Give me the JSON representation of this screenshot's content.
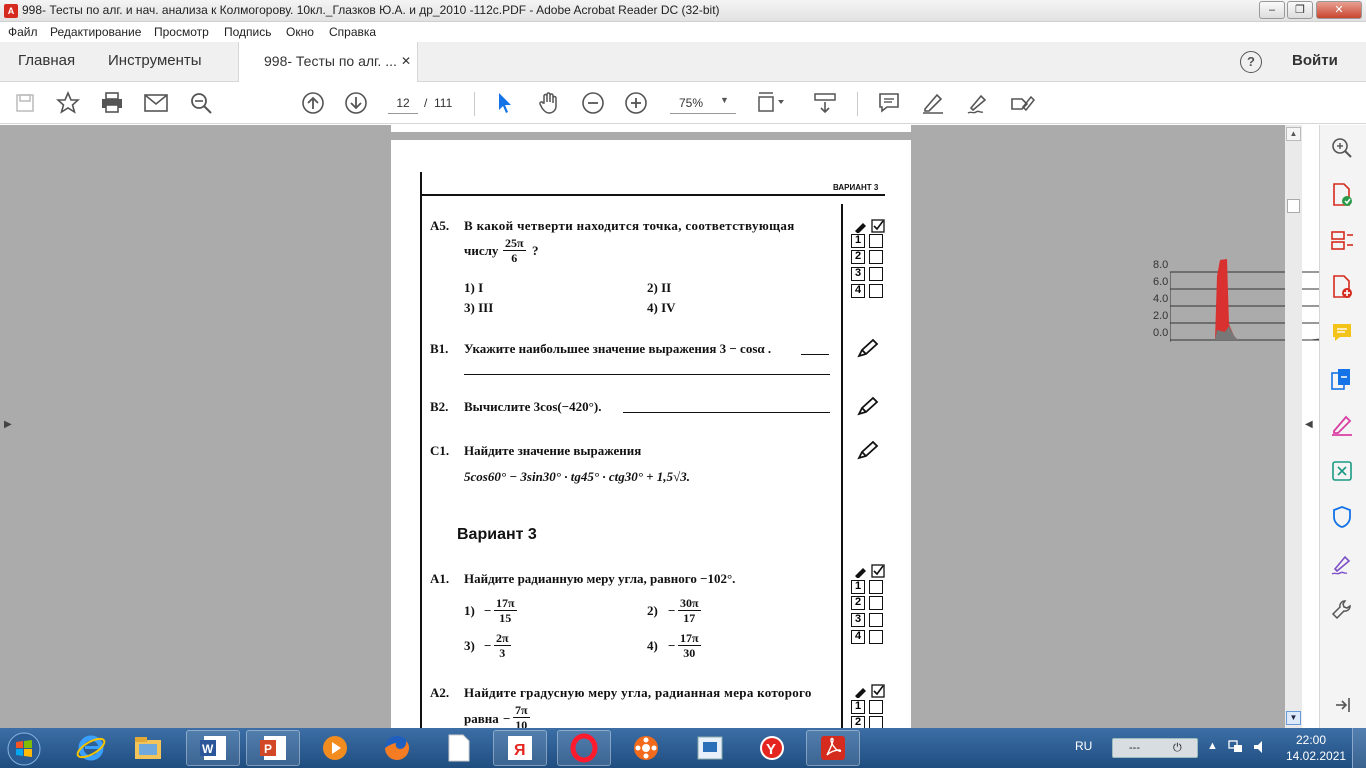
{
  "window": {
    "title": "998- Тесты по алг. и нач. анализа к Колмогорову. 10кл._Глазков Ю.А. и др_2010 -112с.PDF - Adobe Acrobat Reader DC (32-bit)",
    "app_icon": "acrobat-icon",
    "minimize": "–",
    "restore": "❐",
    "close": "✕"
  },
  "menu": [
    "Файл",
    "Редактирование",
    "Просмотр",
    "Подпись",
    "Окно",
    "Справка"
  ],
  "tabs": {
    "home": "Главная",
    "tools": "Инструменты",
    "document": "998- Тесты по алг. ...",
    "close": "✕",
    "help": "?",
    "signin": "Войти"
  },
  "toolbar": {
    "page_current": "12",
    "page_separator": "/",
    "page_total": "111",
    "zoom": "75%"
  },
  "overlay_chart": {
    "ticks": [
      "8.0",
      "6.0",
      "4.0",
      "2.0",
      "0.0"
    ]
  },
  "page": {
    "header": "ВАРИАНТ 3",
    "a5": {
      "num": "А5.",
      "text1": "В какой четверти находится точка, соответствующая",
      "text2": "числу",
      "frac_num": "25π",
      "frac_den": "6",
      "qmark": "?",
      "opt1": "1)  I",
      "opt2": "2)  II",
      "opt3": "3)  III",
      "opt4": "4)  IV"
    },
    "b1": {
      "num": "B1.",
      "text": "Укажите наибольшее значение выражения  3 − cosα ."
    },
    "b2": {
      "num": "B2.",
      "text": "Вычислите 3cos(−420°)."
    },
    "c1": {
      "num": "С1.",
      "text": "Найдите значение выражения",
      "expr": "5cos60° − 3sin30° · tg45° · ctg30° + 1,5√3."
    },
    "variant_title": "Вариант 3",
    "a1": {
      "num": "А1.",
      "text": "Найдите радианную меру угла, равного −102°.",
      "o1_label": "1)",
      "o1_num": "17π",
      "o1_den": "15",
      "o2_label": "2)",
      "o2_num": "30π",
      "o2_den": "17",
      "o3_label": "3)",
      "o3_num": "2π",
      "o3_den": "3",
      "o4_label": "4)",
      "o4_num": "17π",
      "o4_den": "30",
      "minus": "−"
    },
    "a2": {
      "num": "А2.",
      "text1": "Найдите градусную меру угла, радианная мера которого",
      "text2": "равна",
      "frac_num": "7π",
      "frac_den": "10"
    },
    "answer_digits": [
      "1",
      "2",
      "3",
      "4"
    ]
  },
  "taskbar": {
    "lang": "RU",
    "battery": "---",
    "time": "22:00",
    "date": "14.02.2021"
  }
}
